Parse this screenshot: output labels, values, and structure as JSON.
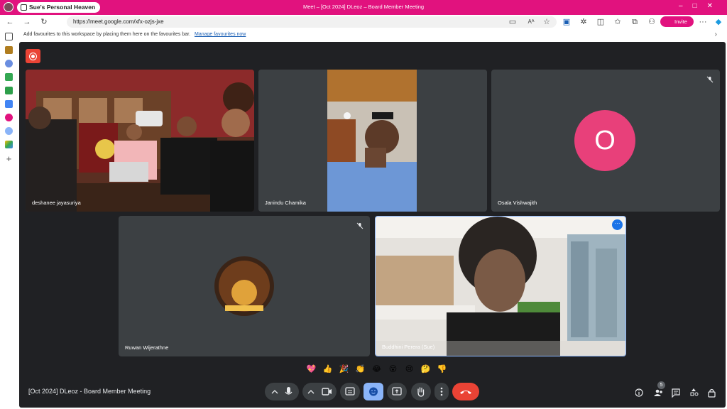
{
  "browser": {
    "profile_name": "Sue's Personal Heaven",
    "window_title": "Meet – [Oct 2024] DLeoz – Board Member Meeting",
    "url": "https://meet.google.com/xfx-ozjs-jxe",
    "invite_label": "Invite",
    "favourites_text": "Add favourites to this workspace by placing them here on the favourites bar.",
    "manage_favourites_link": "Manage favourites now"
  },
  "meeting": {
    "title": "[Oct 2024] DLeoz - Board Member Meeting",
    "participant_count": "5"
  },
  "participants": [
    {
      "name": "deshanee jayasuriya"
    },
    {
      "name": "Janindu Chamika"
    },
    {
      "name": "Osala Vishwajith",
      "avatar_letter": "O",
      "avatar_color": "#e8407a"
    },
    {
      "name": "Ruwan Wijerathne"
    },
    {
      "name": "Buddhini Perera (Sue)"
    }
  ],
  "reactions": [
    "💖",
    "👍",
    "🎉",
    "👏",
    "😂",
    "😮",
    "😢",
    "🤔",
    "👎"
  ],
  "colors": {
    "brand": "#e1127e",
    "meet_bg": "#202124",
    "tile_bg": "#3c4043",
    "end_call": "#ea4335",
    "active_btn": "#8ab4f8"
  }
}
